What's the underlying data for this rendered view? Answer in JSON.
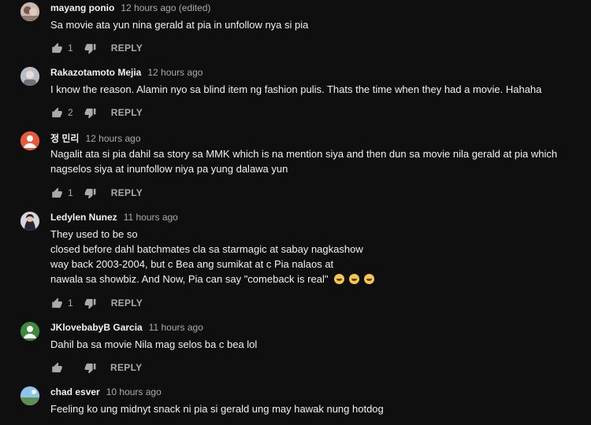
{
  "comments": [
    {
      "author": "mayang ponio",
      "time": "12 hours ago (edited)",
      "lines": [
        "Sa movie ata yun nina gerald at pia in unfollow nya si pia"
      ],
      "likes": "1",
      "reply": "REPLY",
      "avatar": {
        "type": "photo",
        "color": "#b8a49a"
      }
    },
    {
      "author": "Rakazotamoto Mejia",
      "time": "12 hours ago",
      "lines": [
        "I know the reason. Alamin nyo sa blind item ng fashion pulis. Thats the time when they had a movie. Hahaha"
      ],
      "likes": "2",
      "reply": "REPLY",
      "avatar": {
        "type": "photo",
        "color": "#9aa0a6"
      }
    },
    {
      "author": "정 민리",
      "time": "12 hours ago",
      "lines": [
        "Nagalit ata si pia dahil sa story sa MMK which is na mention siya and then dun sa movie nila gerald at pia which",
        "nagselos siya at inunfollow niya pa yung dalawa yun"
      ],
      "likes": "1",
      "reply": "REPLY",
      "avatar": {
        "type": "default",
        "color": "#e8583a"
      }
    },
    {
      "author": "Ledylen Nunez",
      "time": "11 hours ago",
      "lines": [
        "They used to be so",
        "closed before dahl batchmates cla sa starmagic at sabay nagkashow",
        "way back 2003-2004, but c Bea ang sumikat at c Pia nalaos at",
        "nawala sa showbiz. And Now, Pia can say \"comeback is real\""
      ],
      "likes": "1",
      "reply": "REPLY",
      "avatar": {
        "type": "photo",
        "color": "#7d6e86"
      }
    },
    {
      "author": "JKlovebabyB Garcia",
      "time": "11 hours ago",
      "lines": [
        "Dahil ba sa movie Nila mag selos ba c bea lol"
      ],
      "likes": "",
      "reply": "REPLY",
      "avatar": {
        "type": "default",
        "color": "#3d8a3a"
      }
    },
    {
      "author": "chad esver",
      "time": "10 hours ago",
      "lines": [
        "Feeling ko ung midnyt snack ni pia si gerald ung may hawak nung hotdog"
      ],
      "likes": "",
      "reply": "REPLY",
      "avatar": {
        "type": "landscape",
        "color": "#6aa7d8"
      }
    }
  ],
  "icons": {
    "like": "thumb-up-icon",
    "dislike": "thumb-down-icon",
    "emoji": "laughing-emoji-icon"
  },
  "colors": {
    "background": "#0f0f0f",
    "text": "#f1f1f1",
    "secondary": "#aaaaaa"
  }
}
